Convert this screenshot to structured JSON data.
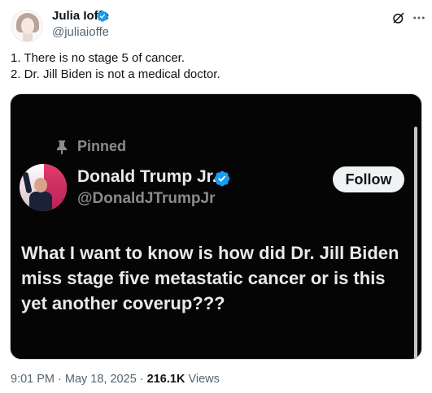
{
  "author": {
    "name": "Julia Ioffe",
    "handle": "@juliaioffe"
  },
  "tweet": {
    "lines": [
      "1. There is no stage 5 of cancer.",
      "2. Dr. Jill Biden is not a medical doctor."
    ]
  },
  "embedded": {
    "pinned_label": "Pinned",
    "name": "Donald Trump Jr.",
    "handle": "@DonaldJTrumpJr",
    "follow_label": "Follow",
    "text_lines": [
      "What I want to know is how did Dr. Jill Biden",
      "miss stage five metastatic cancer or is this",
      "yet another coverup???"
    ]
  },
  "footer": {
    "time": "9:01 PM",
    "sep1": " · ",
    "date": "May 18, 2025",
    "sep2": " · ",
    "views_count": "216.1K",
    "views_label": " Views"
  },
  "icons": {
    "verified": "verified-badge-icon",
    "grok": "grok-icon",
    "more": "more-options-icon",
    "pin": "pin-icon"
  },
  "colors": {
    "verified_blue": "#1d9bf0",
    "text_primary": "#0f1419",
    "text_secondary": "#536471",
    "media_bg": "#050505",
    "media_text": "#e7e9ea"
  }
}
